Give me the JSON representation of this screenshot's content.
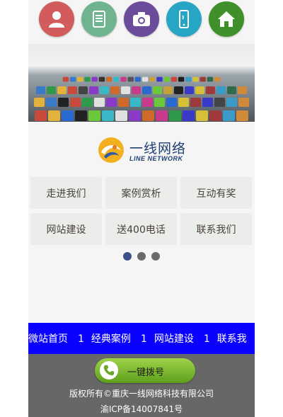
{
  "top_icons": [
    {
      "name": "contact-icon",
      "color": "#d25c5c"
    },
    {
      "name": "document-icon",
      "color": "#6fb38f"
    },
    {
      "name": "camera-icon",
      "color": "#6b4c9b"
    },
    {
      "name": "mobile-phone-icon",
      "color": "#27a5c4"
    },
    {
      "name": "home-icon",
      "color": "#3f8f2b"
    }
  ],
  "logo": {
    "cn": "一线网络",
    "en": "LINE NETWORK"
  },
  "nav_grid": [
    "走进我们",
    "案例赏析",
    "互动有奖",
    "网站建设",
    "送400电话",
    "联系我们"
  ],
  "slider_dots": {
    "count": 3,
    "active": 0
  },
  "marquee": {
    "items": [
      "微站首页",
      "经典案例",
      "网站建设",
      "联系我"
    ],
    "separator": "1",
    "background": "#0a00ff"
  },
  "footer": {
    "call_button": "一键拨号",
    "copyright": "版权所有©重庆一线网络科技有限公司",
    "icp": "渝ICP备14007841号"
  }
}
